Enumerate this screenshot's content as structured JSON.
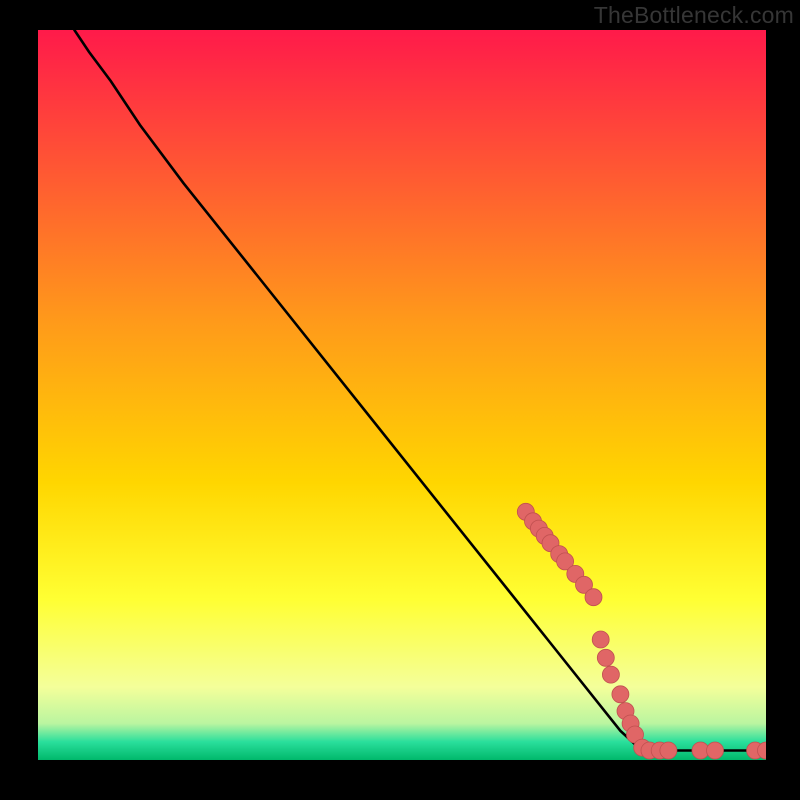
{
  "attribution": "TheBottleneck.com",
  "colors": {
    "frame": "#000000",
    "gradient_top": "#ff1a4a",
    "gradient_mid": "#ffd600",
    "gradient_yellow": "#ffff33",
    "gradient_low": "#f4ff9a",
    "gradient_teal": "#2adf9c",
    "gradient_bottom": "#00b86b",
    "curve": "#000000",
    "marker_fill": "#e06666",
    "marker_stroke": "#c05050"
  },
  "chart_data": {
    "type": "line",
    "title": "",
    "xlabel": "",
    "ylabel": "",
    "xlim": [
      0,
      100
    ],
    "ylim": [
      0,
      100
    ],
    "curve": [
      {
        "x": 5,
        "y": 100
      },
      {
        "x": 7,
        "y": 97
      },
      {
        "x": 10,
        "y": 93
      },
      {
        "x": 14,
        "y": 87
      },
      {
        "x": 20,
        "y": 79
      },
      {
        "x": 30,
        "y": 66.5
      },
      {
        "x": 40,
        "y": 54
      },
      {
        "x": 50,
        "y": 41.5
      },
      {
        "x": 60,
        "y": 29
      },
      {
        "x": 70,
        "y": 16.5
      },
      {
        "x": 80,
        "y": 4
      },
      {
        "x": 82.5,
        "y": 1.7
      },
      {
        "x": 85,
        "y": 1.3
      },
      {
        "x": 90,
        "y": 1.3
      },
      {
        "x": 95,
        "y": 1.3
      },
      {
        "x": 100,
        "y": 1.3
      }
    ],
    "markers": [
      {
        "x": 67.0,
        "y": 34.0
      },
      {
        "x": 68.0,
        "y": 32.7
      },
      {
        "x": 68.8,
        "y": 31.7
      },
      {
        "x": 69.6,
        "y": 30.7
      },
      {
        "x": 70.4,
        "y": 29.7
      },
      {
        "x": 71.6,
        "y": 28.2
      },
      {
        "x": 72.4,
        "y": 27.2
      },
      {
        "x": 73.8,
        "y": 25.5
      },
      {
        "x": 75.0,
        "y": 24.0
      },
      {
        "x": 76.3,
        "y": 22.3
      },
      {
        "x": 77.3,
        "y": 16.5
      },
      {
        "x": 78.0,
        "y": 14.0
      },
      {
        "x": 78.7,
        "y": 11.7
      },
      {
        "x": 80.0,
        "y": 9.0
      },
      {
        "x": 80.7,
        "y": 6.7
      },
      {
        "x": 81.4,
        "y": 5.0
      },
      {
        "x": 82.0,
        "y": 3.5
      },
      {
        "x": 83.0,
        "y": 1.7
      },
      {
        "x": 84.0,
        "y": 1.3
      },
      {
        "x": 85.4,
        "y": 1.3
      },
      {
        "x": 86.6,
        "y": 1.3
      },
      {
        "x": 91.0,
        "y": 1.3
      },
      {
        "x": 93.0,
        "y": 1.3
      },
      {
        "x": 98.5,
        "y": 1.3
      },
      {
        "x": 100.0,
        "y": 1.3
      }
    ]
  }
}
